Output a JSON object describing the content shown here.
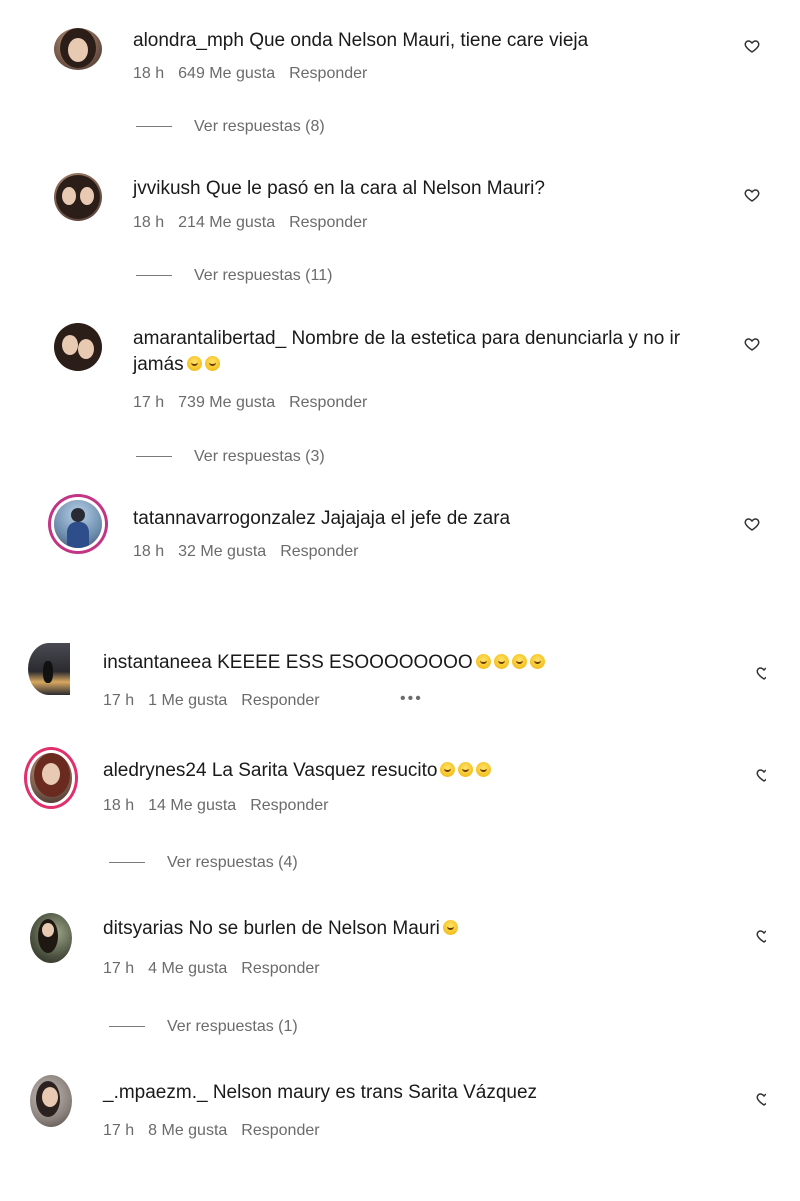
{
  "comments": [
    {
      "username": "alondra_mph",
      "text": "Que onda Nelson Mauri, tiene care vieja",
      "time": "18 h",
      "likes": "649 Me gusta",
      "reply": "Responder",
      "view_replies": "Ver respuestas (8)"
    },
    {
      "username": "jvvikush",
      "text": "Que le pasó en la cara al Nelson Mauri?",
      "time": "18 h",
      "likes": "214 Me gusta",
      "reply": "Responder",
      "view_replies": "Ver respuestas (11)"
    },
    {
      "username": "amarantalibertad_",
      "text": "Nombre de la estetica para denunciarla y no ir jamás",
      "time": "17 h",
      "likes": "739 Me gusta",
      "reply": "Responder",
      "view_replies": "Ver respuestas (3)"
    },
    {
      "username": "tatannavarrogonzalez",
      "text": "Jajajaja el jefe de zara",
      "time": "18 h",
      "likes": "32 Me gusta",
      "reply": "Responder"
    },
    {
      "username": "instantaneea",
      "text": "KEEEE ESS ESOOOOOOOO",
      "time": "17 h",
      "likes": "1 Me gusta",
      "reply": "Responder",
      "more": "•••"
    },
    {
      "username": "aledrynes24",
      "text": "La Sarita Vasquez resucito",
      "time": "18 h",
      "likes": "14 Me gusta",
      "reply": "Responder",
      "view_replies": "Ver respuestas (4)"
    },
    {
      "username": "ditsyarias",
      "text": "No se burlen de Nelson Mauri",
      "time": "17 h",
      "likes": "4 Me gusta",
      "reply": "Responder",
      "view_replies": "Ver respuestas (1)"
    },
    {
      "username": "_.mpaezm._",
      "text": "Nelson maury es trans Sarita Vázquez",
      "time": "17 h",
      "likes": "8 Me gusta",
      "reply": "Responder"
    }
  ],
  "icons": {
    "like": "heart-outline-icon",
    "emoji": "grinning-face-emoji"
  },
  "colors": {
    "meta_text": "#6b6b6b",
    "story_ring": "#c13584"
  }
}
